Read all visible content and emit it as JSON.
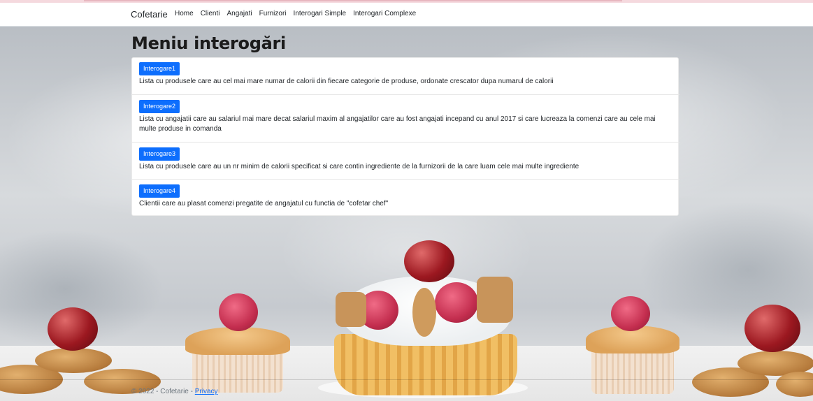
{
  "navbar": {
    "brand": "Cofetarie",
    "links": [
      "Home",
      "Clienti",
      "Angajati",
      "Furnizori",
      "Interogari Simple",
      "Interogari Complexe"
    ]
  },
  "page": {
    "title": "Meniu interogări"
  },
  "queries": [
    {
      "button": "Interogare1",
      "description": "Lista cu produsele care au cel mai mare numar de calorii din fiecare categorie de produse, ordonate crescator dupa numarul de calorii"
    },
    {
      "button": "Interogare2",
      "description": "Lista cu angajatii care au salariul mai mare decat salariul maxim al angajatilor care au fost angajati incepand cu anul 2017 si care lucreaza la comenzi care au cele mai multe produse in comanda"
    },
    {
      "button": "Interogare3",
      "description": "Lista cu produsele care au un nr minim de calorii specificat si care contin ingrediente de la furnizorii de la care luam cele mai multe ingrediente"
    },
    {
      "button": "Interogare4",
      "description": "Clientii care au plasat comenzi pregatite de angajatul cu functia de \"cofetar chef\""
    }
  ],
  "footer": {
    "text": "© 2022 - Cofetarie - ",
    "privacy": "Privacy"
  },
  "colors": {
    "primary": "#0d6efd",
    "navbar_bg": "#ffffff"
  }
}
